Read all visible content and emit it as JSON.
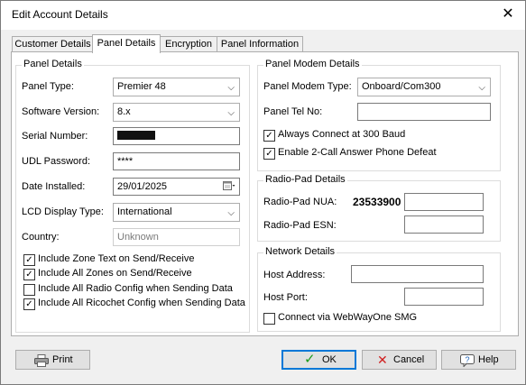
{
  "window": {
    "title": "Edit Account Details",
    "close_glyph": "✕"
  },
  "tabs": [
    "Customer Details",
    "Panel Details",
    "Encryption",
    "Panel Information"
  ],
  "panel_details": {
    "group_title": "Panel Details",
    "panel_type_label": "Panel Type:",
    "panel_type_value": "Premier 48",
    "software_version_label": "Software Version:",
    "software_version_value": "8.x",
    "serial_number_label": "Serial Number:",
    "udl_password_label": "UDL Password:",
    "udl_password_value": "****",
    "date_installed_label": "Date Installed:",
    "date_installed_value": "29/01/2025",
    "lcd_display_type_label": "LCD Display Type:",
    "lcd_display_type_value": "International",
    "country_label": "Country:",
    "country_value": "Unknown"
  },
  "options": [
    {
      "label": "Include Zone Text on Send/Receive",
      "checked": true
    },
    {
      "label": "Include All Zones on Send/Receive",
      "checked": true
    },
    {
      "label": "Include All Radio Config when Sending Data",
      "checked": false
    },
    {
      "label": "Include All Ricochet Config when Sending Data",
      "checked": true
    }
  ],
  "modem_details": {
    "group_title": "Panel Modem Details",
    "modem_type_label": "Panel Modem Type:",
    "modem_type_value": "Onboard/Com300",
    "panel_tel_label": "Panel Tel No:",
    "panel_tel_value": "",
    "always_300_label": "Always Connect at 300 Baud",
    "always_300_checked": true,
    "enable_2call_label": "Enable 2-Call Answer Phone Defeat",
    "enable_2call_checked": true
  },
  "radio_pad": {
    "group_title": "Radio-Pad Details",
    "nua_label": "Radio-Pad NUA:",
    "nua_value": "23533900",
    "nua_field_value": "",
    "esn_label": "Radio-Pad ESN:",
    "esn_value": ""
  },
  "network": {
    "group_title": "Network Details",
    "host_address_label": "Host Address:",
    "host_address_value": "",
    "host_port_label": "Host Port:",
    "host_port_value": "",
    "webwayone_label": "Connect via WebWayOne SMG",
    "webwayone_checked": false
  },
  "buttons": {
    "print": "Print",
    "ok": "OK",
    "cancel": "Cancel",
    "help": "Help"
  },
  "icons": {
    "dropdown": "chevron-down-icon",
    "calendar": "calendar-icon",
    "print": "printer-icon",
    "ok": "check-icon",
    "cancel": "x-icon",
    "help": "help-icon"
  }
}
